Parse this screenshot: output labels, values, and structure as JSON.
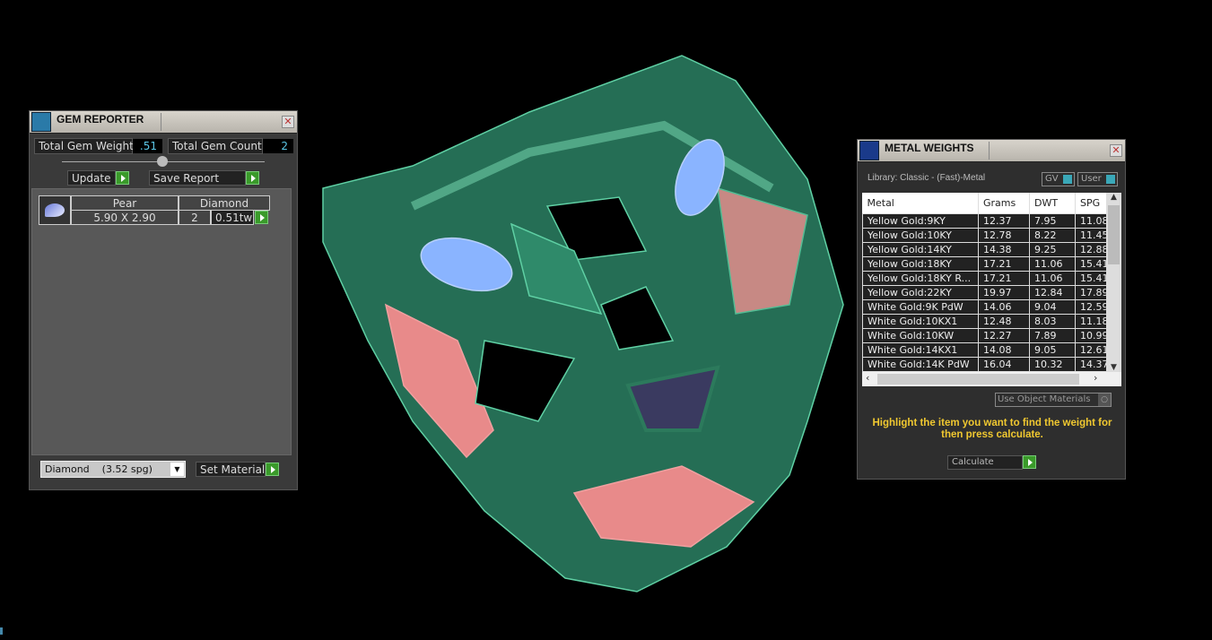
{
  "gem_reporter": {
    "title": "GEM REPORTER",
    "total_weight_label": "Total Gem Weight",
    "total_weight": ".51",
    "total_count_label": "Total Gem Count",
    "total_count": "2",
    "update_label": "Update",
    "save_label": "Save Report",
    "gems": [
      {
        "shape": "Pear",
        "material": "Diamond",
        "size": "5.90 X 2.90",
        "count": "2",
        "weight": "0.51tw"
      }
    ],
    "material_select": "Diamond    (3.52 spg)",
    "set_material_label": "Set Material"
  },
  "metal_weights": {
    "title": "METAL WEIGHTS",
    "library": "Library: Classic - (Fast)-Metal",
    "gv_label": "GV",
    "user_label": "User",
    "columns": [
      "Metal",
      "Grams",
      "DWT",
      "SPG"
    ],
    "rows": [
      [
        "Yellow Gold:9KY",
        "12.37",
        "7.95",
        "11.08"
      ],
      [
        "Yellow Gold:10KY",
        "12.78",
        "8.22",
        "11.45"
      ],
      [
        "Yellow Gold:14KY",
        "14.38",
        "9.25",
        "12.88"
      ],
      [
        "Yellow Gold:18KY",
        "17.21",
        "11.06",
        "15.41"
      ],
      [
        "Yellow Gold:18KY R...",
        "17.21",
        "11.06",
        "15.41"
      ],
      [
        "Yellow Gold:22KY",
        "19.97",
        "12.84",
        "17.89"
      ],
      [
        "White Gold:9K PdW",
        "14.06",
        "9.04",
        "12.59"
      ],
      [
        "White Gold:10KX1",
        "12.48",
        "8.03",
        "11.18"
      ],
      [
        "White Gold:10KW",
        "12.27",
        "7.89",
        "10.99"
      ],
      [
        "White Gold:14KX1",
        "14.08",
        "9.05",
        "12.61"
      ],
      [
        "White Gold:14K PdW",
        "16.04",
        "10.32",
        "14.37"
      ]
    ],
    "use_object_materials": "Use Object Materials",
    "hint": "Highlight the item you want to find the weight for then press calculate.",
    "calculate_label": "Calculate"
  },
  "colors": {
    "model": "#2e8a68",
    "pink": "#f08080",
    "gem": "#8ab4ff"
  }
}
